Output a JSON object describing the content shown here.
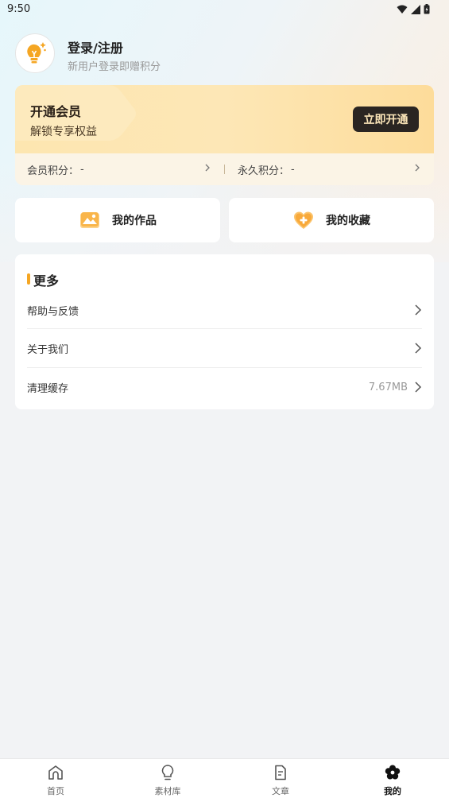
{
  "status_bar": {
    "time": "9:50"
  },
  "profile": {
    "title": "登录/注册",
    "subtitle": "新用户登录即赠积分"
  },
  "vip": {
    "title": "开通会员",
    "subtitle": "解锁专享权益",
    "button": "立即开通",
    "member_points_label": "会员积分：",
    "member_points_value": "-",
    "permanent_points_label": "永久积分：",
    "permanent_points_value": "-"
  },
  "tiles": {
    "works": "我的作品",
    "favorites": "我的收藏"
  },
  "more": {
    "title": "更多",
    "items": [
      {
        "label": "帮助与反馈",
        "value": ""
      },
      {
        "label": "关于我们",
        "value": ""
      },
      {
        "label": "清理缓存",
        "value": "7.67MB"
      }
    ]
  },
  "bottom_nav": {
    "items": [
      {
        "label": "首页",
        "icon": "home-icon"
      },
      {
        "label": "素材库",
        "icon": "lightbulb-icon"
      },
      {
        "label": "文章",
        "icon": "document-icon"
      },
      {
        "label": "我的",
        "icon": "flower-icon"
      }
    ],
    "active": "我的"
  },
  "colors": {
    "accent": "#f5a623",
    "vip_button": "#2a2522",
    "vip_gold": "#fde6b0"
  }
}
